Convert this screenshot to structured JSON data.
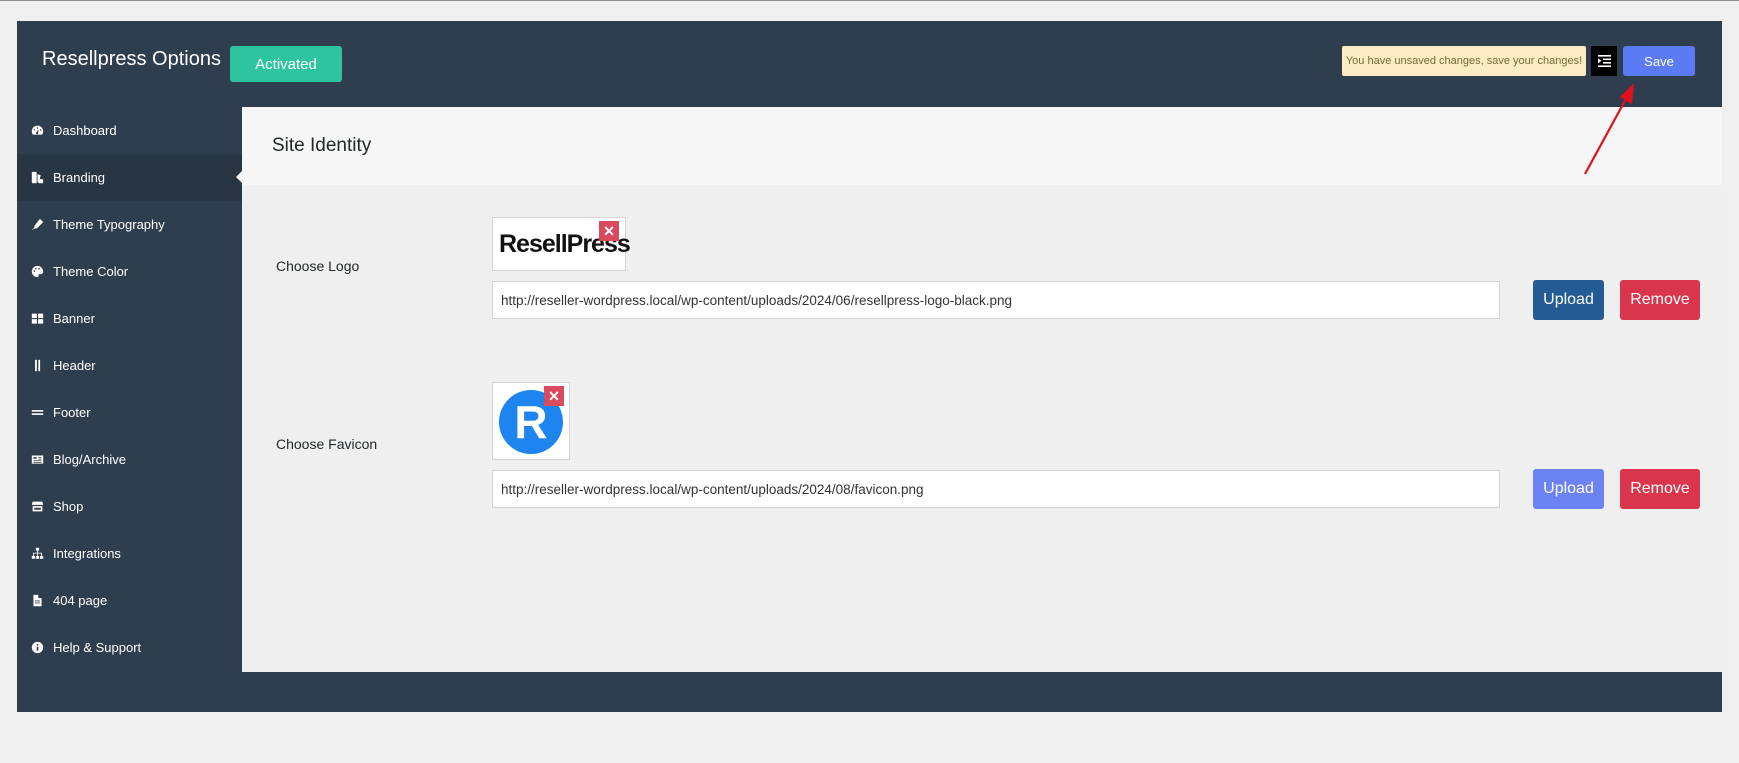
{
  "header": {
    "title": "Resellpress Options",
    "status_badge": "Activated",
    "unsaved_notice": "You have unsaved changes, save your changes!",
    "save_label": "Save"
  },
  "sidebar": {
    "items": [
      {
        "label": "Dashboard",
        "icon": "dashboard-icon"
      },
      {
        "label": "Branding",
        "icon": "branding-icon",
        "active": true
      },
      {
        "label": "Theme Typography",
        "icon": "pen-icon"
      },
      {
        "label": "Theme Color",
        "icon": "palette-icon"
      },
      {
        "label": "Banner",
        "icon": "grid-icon"
      },
      {
        "label": "Header",
        "icon": "header-bars-icon"
      },
      {
        "label": "Footer",
        "icon": "footer-lines-icon"
      },
      {
        "label": "Blog/Archive",
        "icon": "blog-icon"
      },
      {
        "label": "Shop",
        "icon": "store-icon"
      },
      {
        "label": "Integrations",
        "icon": "sitemap-icon"
      },
      {
        "label": "404 page",
        "icon": "file-icon"
      },
      {
        "label": "Help & Support",
        "icon": "info-icon"
      }
    ]
  },
  "main": {
    "section_title": "Site Identity",
    "logo": {
      "label": "Choose Logo",
      "preview_text": "ResellPress",
      "url": "http://reseller-wordpress.local/wp-content/uploads/2024/06/resellpress-logo-black.png",
      "upload_label": "Upload",
      "remove_label": "Remove"
    },
    "favicon": {
      "label": "Choose Favicon",
      "preview_letter": "R",
      "url": "http://reseller-wordpress.local/wp-content/uploads/2024/08/favicon.png",
      "upload_label": "Upload",
      "remove_label": "Remove"
    }
  },
  "colors": {
    "panel": "#2f3e4e",
    "accent_green": "#2dc5a1",
    "save_blue": "#5b7bf5",
    "upload_dark": "#235c95",
    "upload_light": "#6c83f3",
    "remove_red": "#d9364d",
    "arrow_red": "#e0101d",
    "favicon_blue": "#1d84f0"
  }
}
